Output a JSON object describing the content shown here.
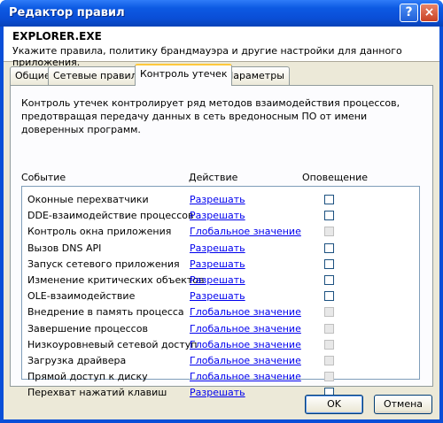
{
  "window": {
    "title": "Редактор правил",
    "help_glyph": "?",
    "close_glyph": "×"
  },
  "header": {
    "app_name": "EXPLORER.EXE",
    "description": "Укажите правила, политику брандмауэра и другие настройки для данного приложения."
  },
  "tabs": [
    {
      "label": "Общие"
    },
    {
      "label": "Сетевые правила"
    },
    {
      "label": "Контроль утечек",
      "active": true
    },
    {
      "label": "Параметры"
    }
  ],
  "panel": {
    "intro": "Контроль утечек контролирует ряд методов взаимодействия процессов, предотвращая передачу данных в сеть вредоносным ПО от имени доверенных программ.",
    "columns": {
      "event": "Событие",
      "action": "Действие",
      "alert": "Оповещение"
    },
    "rows": [
      {
        "event": "Оконные перехватчики",
        "action": "Разрешать",
        "alert_enabled": true
      },
      {
        "event": "DDE-взаимодействие процессов",
        "action": "Разрешать",
        "alert_enabled": true
      },
      {
        "event": "Контроль окна приложения",
        "action": "Глобальное значение",
        "alert_enabled": false
      },
      {
        "event": "Вызов DNS API",
        "action": "Разрешать",
        "alert_enabled": true
      },
      {
        "event": "Запуск сетевого приложения",
        "action": "Разрешать",
        "alert_enabled": true
      },
      {
        "event": "Изменение критических объектов",
        "action": "Разрешать",
        "alert_enabled": true
      },
      {
        "event": "OLE-взаимодействие",
        "action": "Разрешать",
        "alert_enabled": true
      },
      {
        "event": "Внедрение в память процесса",
        "action": "Глобальное значение",
        "alert_enabled": false
      },
      {
        "event": "Завершение процессов",
        "action": "Глобальное значение",
        "alert_enabled": false
      },
      {
        "event": "Низкоуровневый сетевой доступ",
        "action": "Глобальное значение",
        "alert_enabled": false
      },
      {
        "event": "Загрузка драйвера",
        "action": "Глобальное значение",
        "alert_enabled": false
      },
      {
        "event": "Прямой доступ к диску",
        "action": "Глобальное значение",
        "alert_enabled": false
      },
      {
        "event": "Перехват нажатий клавиш",
        "action": "Разрешать",
        "alert_enabled": true
      }
    ]
  },
  "buttons": {
    "ok": "OK",
    "cancel": "Отмена"
  }
}
